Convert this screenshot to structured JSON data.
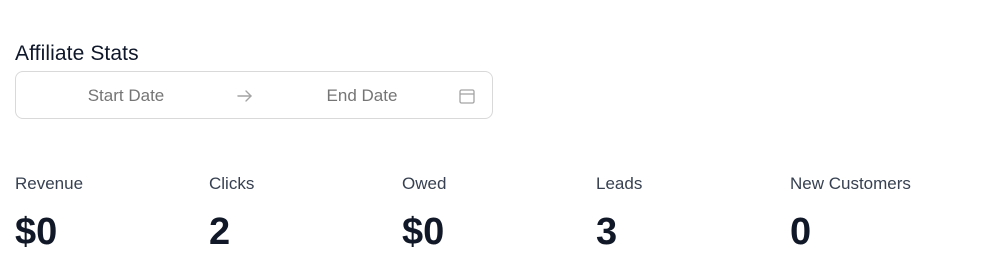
{
  "page": {
    "title": "Affiliate Stats"
  },
  "date_range": {
    "start_placeholder": "Start Date",
    "end_placeholder": "End Date",
    "separator_icon": "arrow-right-icon",
    "calendar_icon": "calendar-icon"
  },
  "stats": [
    {
      "label": "Revenue",
      "value": "$0"
    },
    {
      "label": "Clicks",
      "value": "2"
    },
    {
      "label": "Owed",
      "value": "$0"
    },
    {
      "label": "Leads",
      "value": "3"
    },
    {
      "label": "New Customers",
      "value": "0"
    }
  ],
  "colors": {
    "text_primary": "#111827",
    "text_label": "#374151",
    "placeholder": "#bfbfbf",
    "border": "#d9d9d9",
    "icon": "#a3a3a3"
  }
}
